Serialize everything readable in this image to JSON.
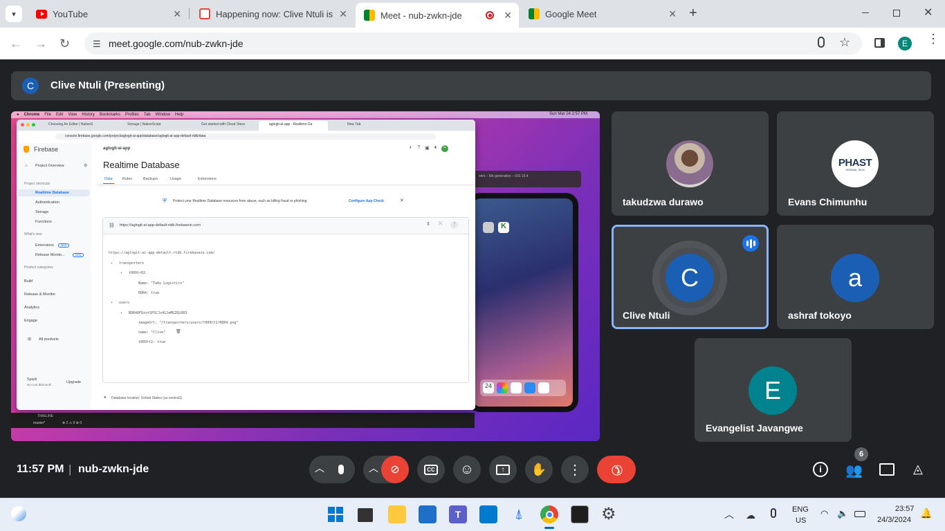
{
  "browser": {
    "tabs": [
      {
        "title": "YouTube",
        "color": "#ff0000"
      },
      {
        "title": "Happening now: Clive Ntuli is in",
        "color": "#ea4335"
      },
      {
        "title": "Meet - nub-zwkn-jde",
        "color": "#00832d"
      },
      {
        "title": "Google Meet",
        "color": "#00832d"
      }
    ],
    "url": "meet.google.com/nub-zwkn-jde",
    "profile_initial": "E"
  },
  "meet": {
    "presenter_initial": "C",
    "presenter_label": "Clive Ntuli (Presenting)",
    "participants": [
      {
        "name": "takudzwa durawo"
      },
      {
        "name": "Evans Chimunhu",
        "logo_text": "PHAST",
        "logo_sub": "ORIGINAL TECH"
      },
      {
        "name": "Clive Ntuli",
        "initial": "C",
        "speaking": true
      },
      {
        "name": "ashraf tokoyo",
        "initial": "a"
      },
      {
        "name": "Evangelist Javangwe",
        "initial": "E"
      }
    ],
    "time": "11:57 PM",
    "separator": "|",
    "meeting_code": "nub-zwkn-jde",
    "people_count": "6"
  },
  "shared": {
    "mac_menu": [
      "Chrome",
      "File",
      "Edit",
      "View",
      "History",
      "Bookmarks",
      "Profiles",
      "Tab",
      "Window",
      "Help"
    ],
    "mac_clock": "Sun Mar 24  2:57 PM",
    "inner_tabs": [
      "Choosing An Editor | NativeS",
      "Storage | NativeScript",
      "Get started with Cloud Stora",
      "aglogit-ai-app - Realtime Da",
      "New Tab"
    ],
    "inner_url": "console.firebase.google.com/project/aglogit-ai-app/database/aglogit-ai-app-default-rtdb/data",
    "firebase": "Firebase",
    "project_overview": "Project Overview",
    "project_shortcuts": "Project shortcuts",
    "side_items": [
      "Realtime Database",
      "Authentication",
      "Storage",
      "Functions"
    ],
    "whats_new": "What's new",
    "new_items": [
      "Extensions",
      "Release Monito..."
    ],
    "new_badge": "NEW",
    "product_categories": "Product categories",
    "categories": [
      "Build",
      "Release & Monitor",
      "Analytics",
      "Engage"
    ],
    "all_products": "All products",
    "plan": "Spark",
    "plan_sub": "No-cost $0/month",
    "upgrade": "Upgrade",
    "project": "aglogit-ai-app",
    "heading": "Realtime Database",
    "db_tabs": [
      "Data",
      "Rules",
      "Backups",
      "Usage",
      "Extensions"
    ],
    "protect_msg": "Protect your Realtime Database resources from abuse, such as billing fraud or phishing",
    "configure": "Configure App Check",
    "db_url": "https://aglogit-ai-app-default-rtdb.firebaseio.com",
    "tree": [
      {
        "text": "https://aglogit-ai-app-default-rtdb.firebaseio.com/",
        "indent": 0
      },
      {
        "text": "transporters",
        "indent": 1
      },
      {
        "text": "t009tr02",
        "indent": 2
      },
      {
        "text": "Name: \"Taku Logistics\"",
        "indent": 3
      },
      {
        "text": "RDR4: true",
        "indent": 3
      },
      {
        "text": "users",
        "indent": 1
      },
      {
        "text": "RDR48F8zvtSPSCJx41JeMGZQLR83",
        "indent": 2
      },
      {
        "text": "imageUrl: \"/transporters/users/t009tf2/RDR4.png\"",
        "indent": 3
      },
      {
        "text": "name: \"Clive\"",
        "indent": 3
      },
      {
        "text": "t009tf2: true",
        "indent": 3
      }
    ],
    "db_location": "Database location: United States (us-central1)",
    "timeline": "TIMELINE",
    "branch": "master*",
    "status": "⊗ 2 ⚠ 0    ⊕ 0",
    "sim_title": "mini – 6th generation – iOS 15.4",
    "dock_date": "24"
  },
  "taskbar": {
    "lang": "ENG",
    "region": "US",
    "time": "23:57",
    "date": "24/3/2024"
  }
}
